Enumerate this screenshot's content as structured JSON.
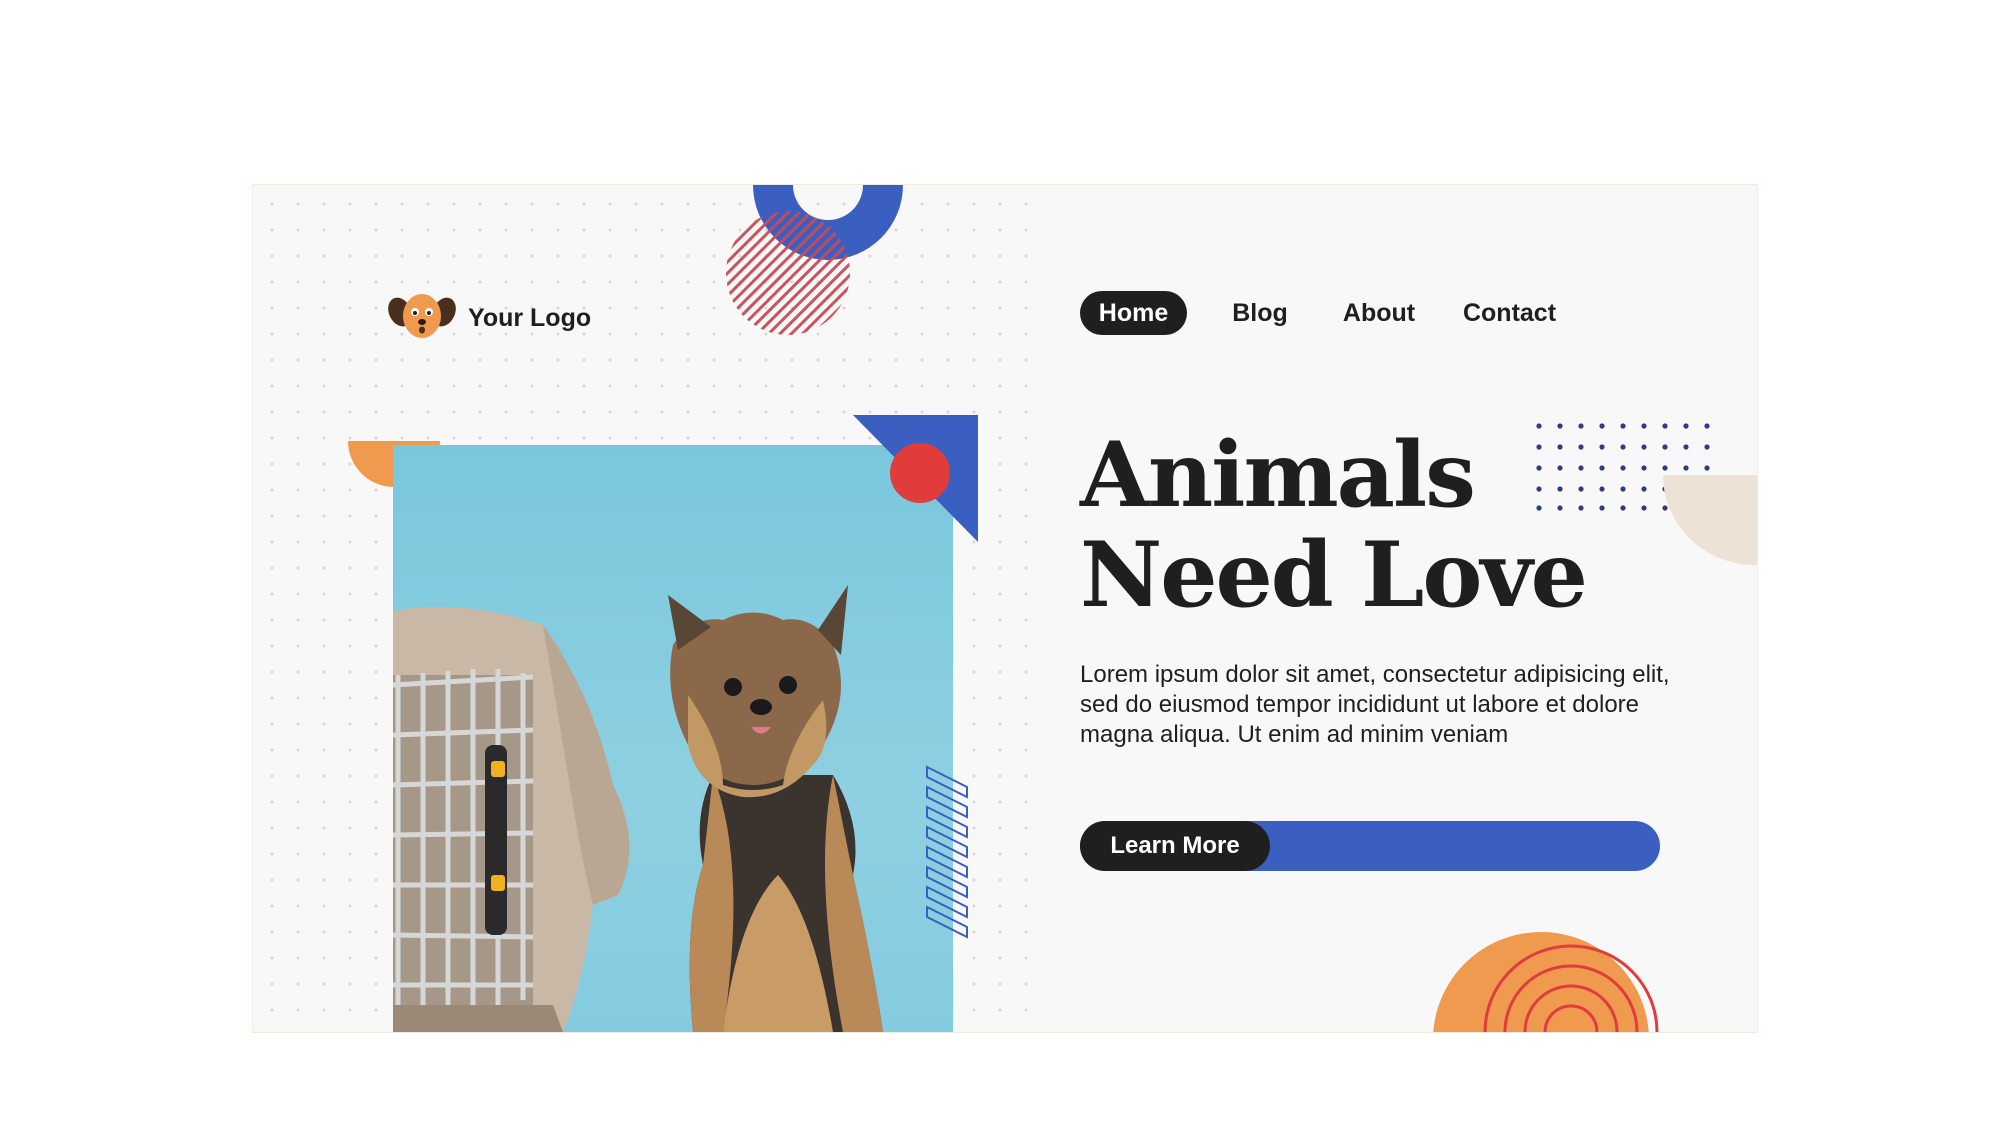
{
  "logo": {
    "text": "Your Logo",
    "icon": "dog-head-icon"
  },
  "nav": {
    "items": [
      {
        "label": "Home",
        "active": true
      },
      {
        "label": "Blog",
        "active": false
      },
      {
        "label": "About",
        "active": false
      },
      {
        "label": "Contact",
        "active": false
      }
    ]
  },
  "hero": {
    "title_line1": "Animals",
    "title_line2": "Need Love",
    "description": "Lorem ipsum dolor sit amet, consectetur adipisicing elit, sed do eiusmod tempor incididunt ut labore et dolore magna aliqua. Ut enim ad minim veniam",
    "cta_label": "Learn More",
    "image": "yorkshire-terrier-with-pet-carrier"
  },
  "colors": {
    "accent_blue": "#3b5fc0",
    "accent_orange": "#ef9a4f",
    "accent_red": "#e03c3c",
    "dark": "#1f1f1f",
    "beige": "#ece3d6",
    "photo_bg": "#84cbe0"
  }
}
